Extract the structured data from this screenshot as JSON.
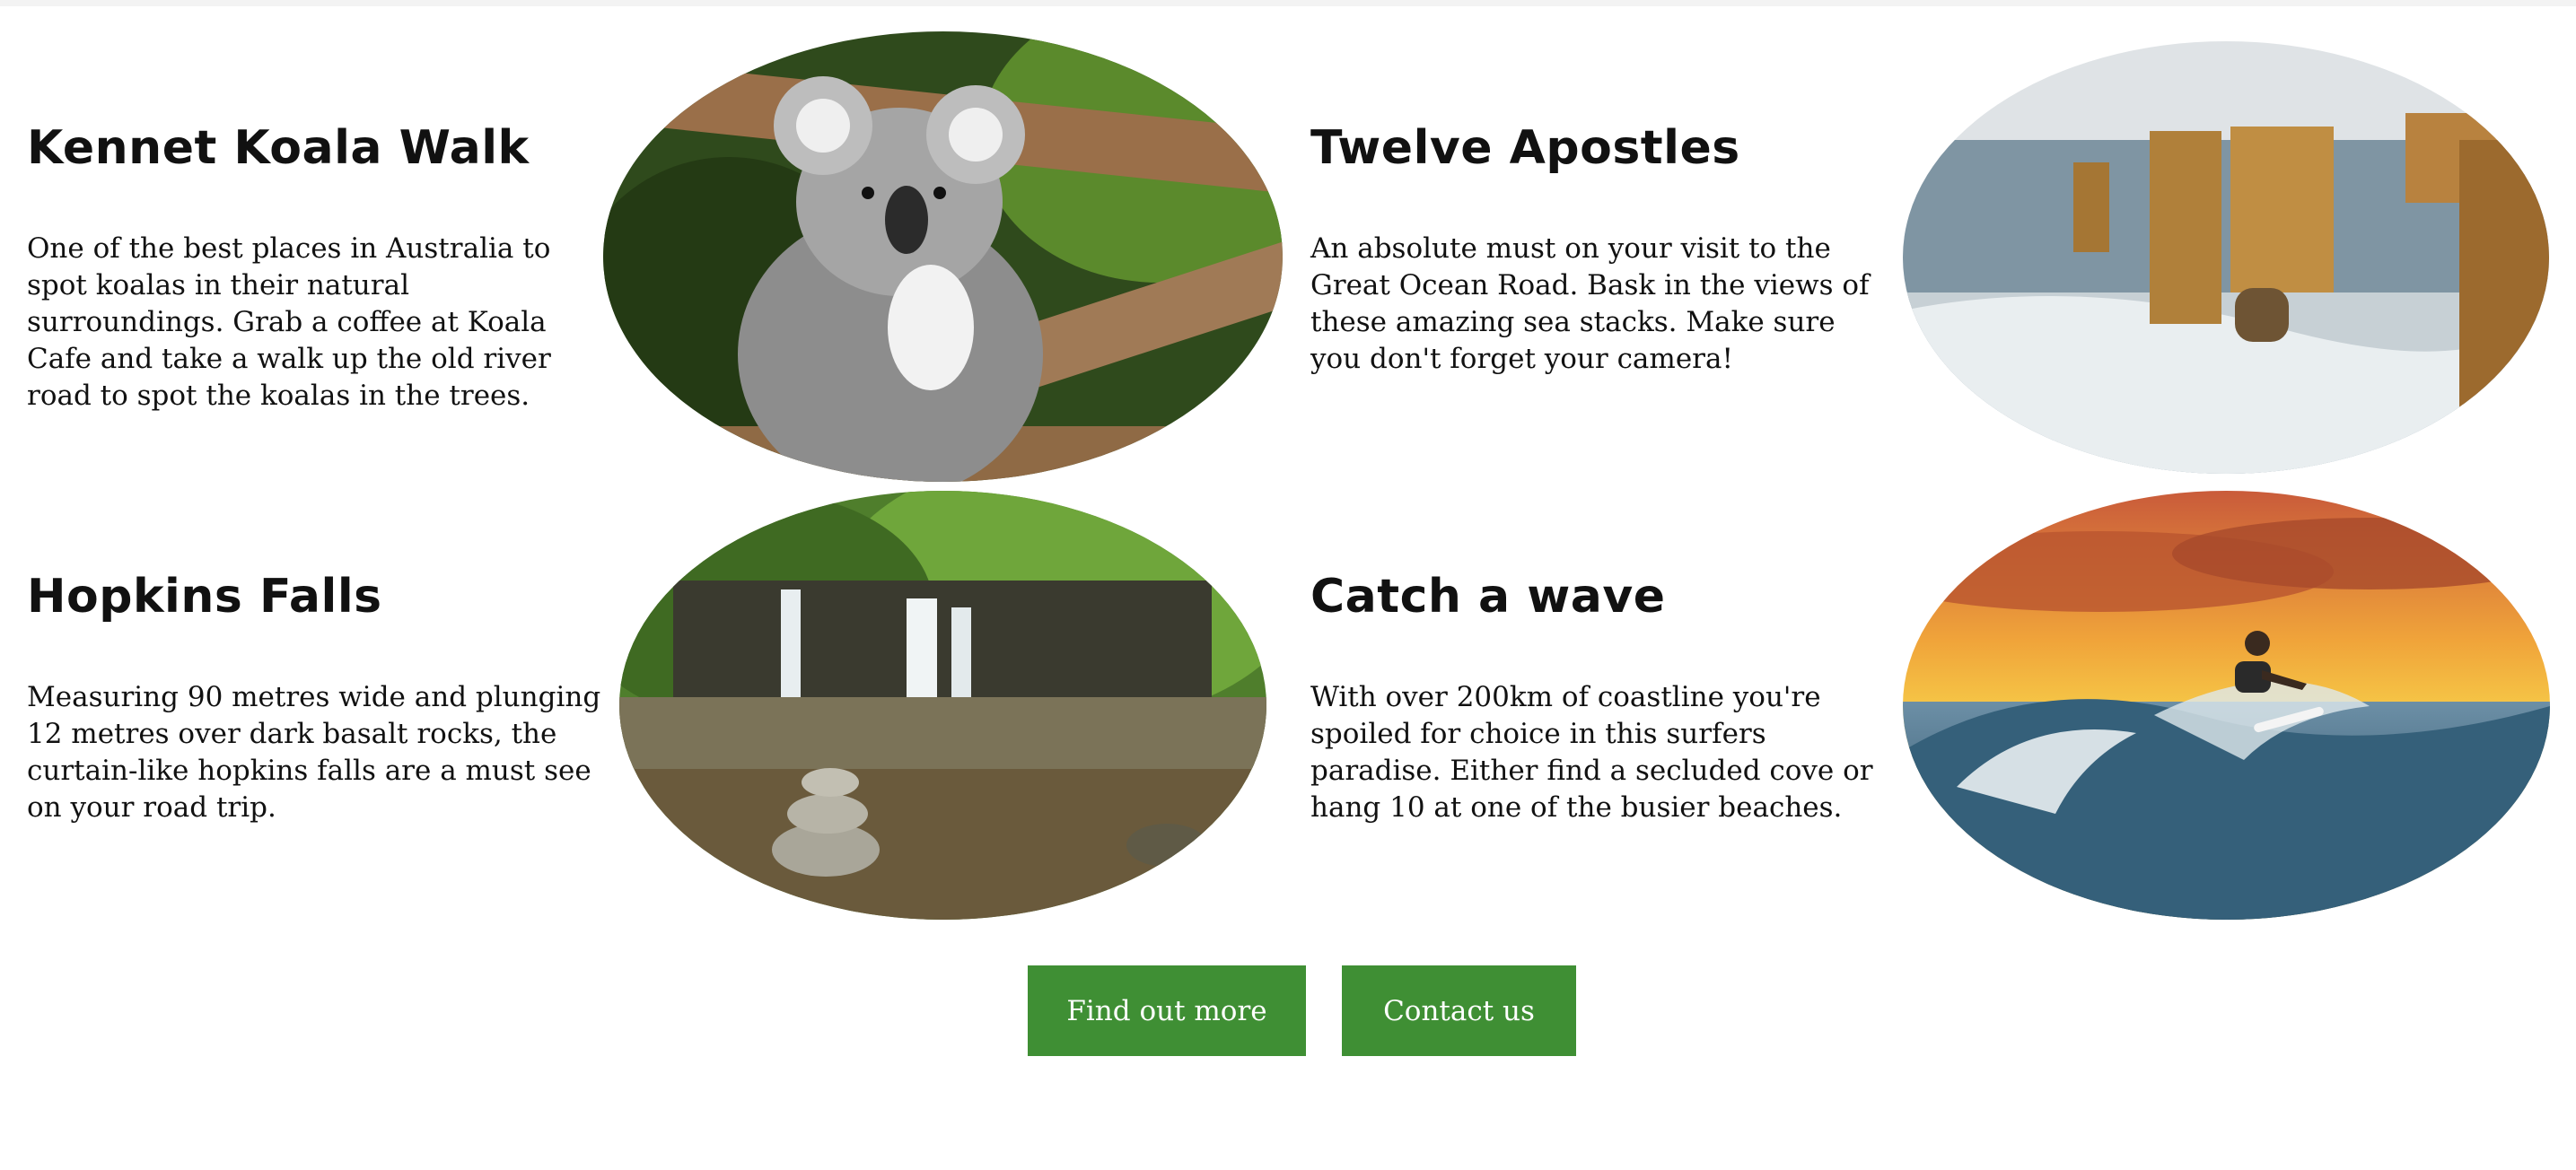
{
  "cards": [
    {
      "title": "Kennet Koala Walk",
      "description": "One of the best places in Australia to spot koalas in their natural surroundings. Grab a coffee at Koala Cafe and take a walk up the old river road to spot the koalas in the trees.",
      "image_icon": "koala-photo"
    },
    {
      "title": "Twelve Apostles",
      "description": "An absolute must on your visit to the Great Ocean Road. Bask in the views of these amazing sea stacks. Make sure you don't forget your camera!",
      "image_icon": "sea-stacks-photo"
    },
    {
      "title": "Hopkins Falls",
      "description": "Measuring 90 metres wide and plunging 12 metres over dark basalt rocks, the curtain-like hopkins falls are a must see on your road trip.",
      "image_icon": "waterfall-photo"
    },
    {
      "title": "Catch a wave",
      "description": "With over 200km of coastline you're spoiled for choice in this surfers paradise. Either find a secluded cove or hang 10 at one of the busier beaches.",
      "image_icon": "surfer-photo"
    }
  ],
  "buttons": {
    "find_out_more": "Find out more",
    "contact_us": "Contact us"
  },
  "colors": {
    "button_bg": "#3f8f34",
    "button_text": "#ffffff",
    "text": "#111111"
  }
}
